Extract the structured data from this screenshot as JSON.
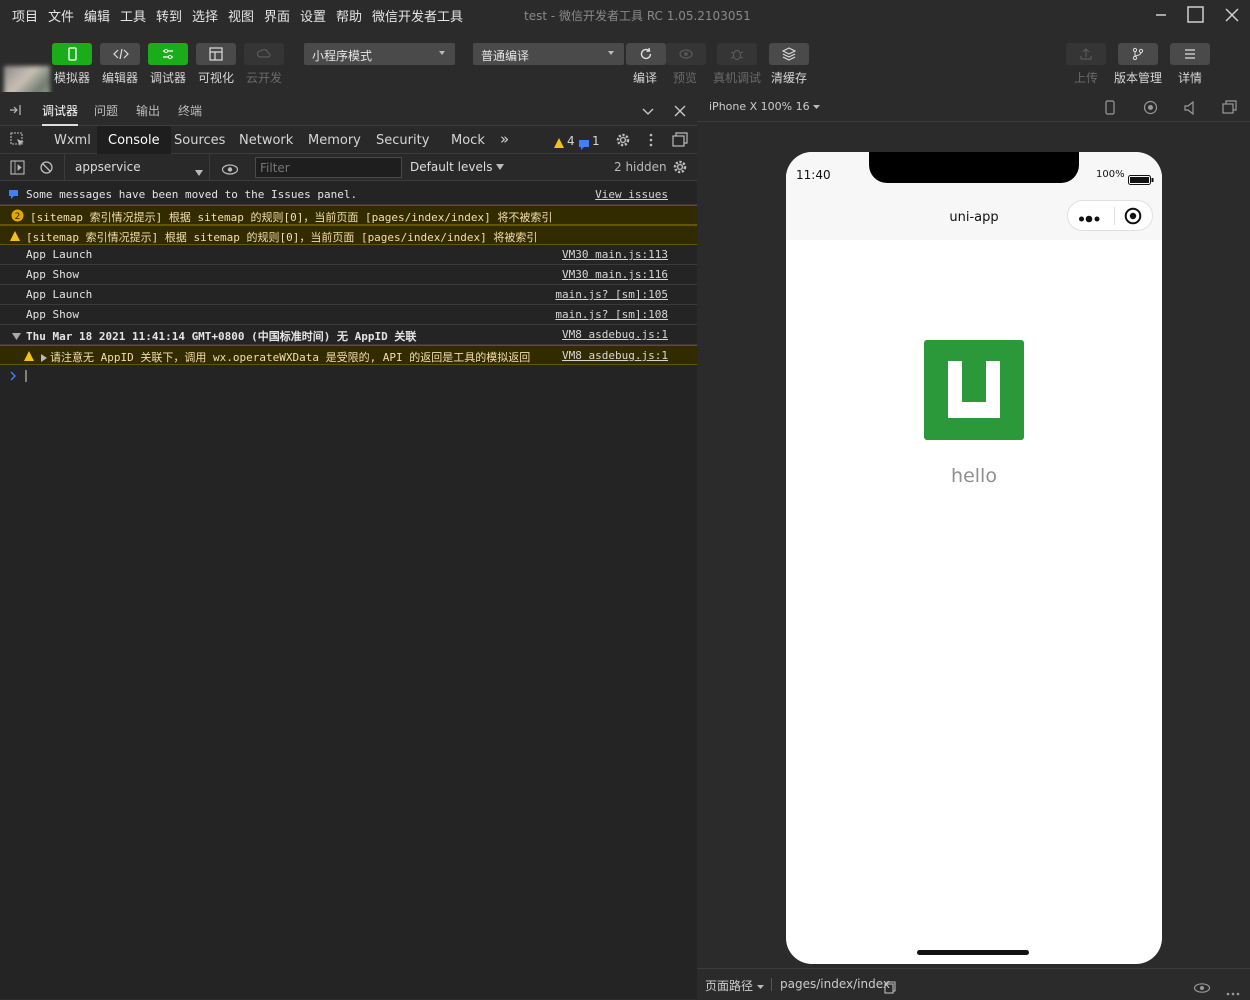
{
  "menubar": {
    "items": [
      "项目",
      "文件",
      "编辑",
      "工具",
      "转到",
      "选择",
      "视图",
      "界面",
      "设置",
      "帮助",
      "微信开发者工具"
    ],
    "title": "test - 微信开发者工具 RC 1.05.2103051"
  },
  "toolbar": {
    "simulator": "模拟器",
    "editor": "编辑器",
    "debugger": "调试器",
    "visual": "可视化",
    "cloud": "云开发",
    "mode_select": "小程序模式",
    "compile_select": "普通编译",
    "compile": "编译",
    "preview": "预览",
    "real_debug": "真机调试",
    "clear_cache": "清缓存",
    "upload": "上传",
    "version": "版本管理",
    "details": "详情"
  },
  "devtools": {
    "panel_tabs": [
      "调试器",
      "问题",
      "输出",
      "终端"
    ],
    "tabs": [
      "Wxml",
      "Console",
      "Sources",
      "Network",
      "Memory",
      "Security",
      "Mock"
    ],
    "warn_count": "4",
    "info_count": "1",
    "context": "appservice",
    "filter_placeholder": "Filter",
    "levels": "Default levels",
    "hidden": "2 hidden"
  },
  "console": {
    "rows": [
      {
        "msg": "Some messages have been moved to the Issues panel.",
        "src": "View issues"
      },
      {
        "msg": "[sitemap 索引情况提示] 根据 sitemap 的规则[0]，当前页面 [pages/index/index] 将不被索引",
        "src": ""
      },
      {
        "msg": "[sitemap 索引情况提示] 根据 sitemap 的规则[0]，当前页面 [pages/index/index] 将被索引",
        "src": ""
      },
      {
        "msg": "App Launch",
        "src": "VM30 main.js:113"
      },
      {
        "msg": "App Show",
        "src": "VM30 main.js:116"
      },
      {
        "msg": "App Launch",
        "src": "main.js? [sm]:105"
      },
      {
        "msg": "App Show",
        "src": "main.js? [sm]:108"
      },
      {
        "msg": "Thu Mar 18 2021 11:41:14 GMT+0800 (中国标准时间) 无 AppID 关联",
        "src": "VM8 asdebug.js:1"
      },
      {
        "msg": "请注意无 AppID 关联下，调用 wx.operateWXData 是受限的, API 的返回是工具的模拟返回",
        "src": "VM8 asdebug.js:1"
      }
    ]
  },
  "simulator": {
    "device": "iPhone X 100% 16",
    "time": "11:40",
    "battery": "100%",
    "nav_title": "uni-app",
    "content_text": "hello",
    "footer_label": "页面路径",
    "footer_path": "pages/index/index"
  },
  "colors": {
    "accent": "#1aad19",
    "logo": "#2b9939",
    "warn_bg": "#332b00"
  }
}
